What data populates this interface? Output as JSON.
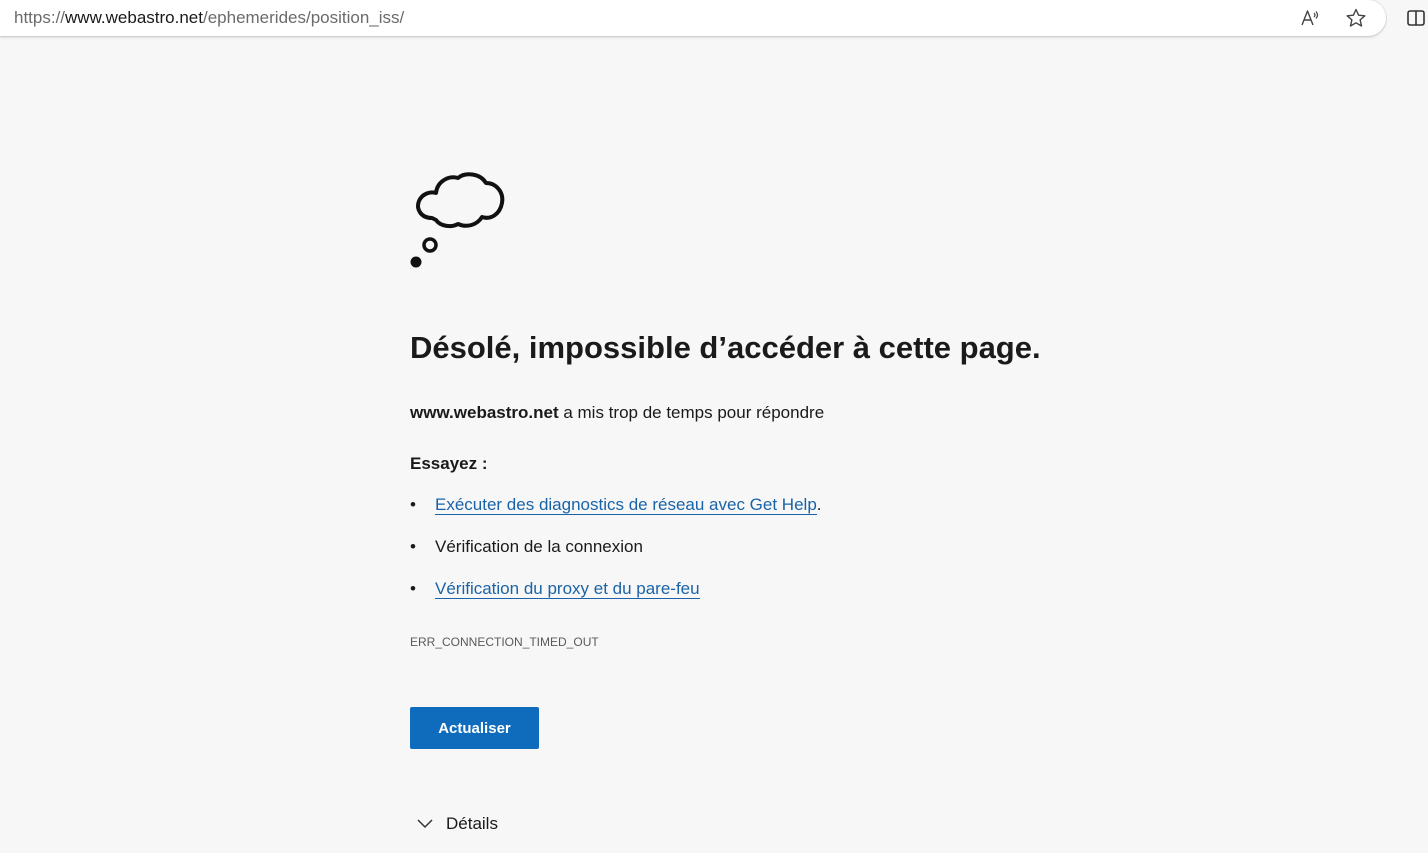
{
  "browser": {
    "url_scheme": "https://",
    "url_host": "www.webastro.net",
    "url_path": "/ephemerides/position_iss/",
    "icons": [
      "read-aloud-icon",
      "favorite-star-icon",
      "split-screen-icon"
    ]
  },
  "error_page": {
    "illustration": "thought-cloud-icon",
    "title": "Désolé, impossible d’accéder à cette page.",
    "host": "www.webastro.net",
    "message": " a mis trop de temps pour répondre",
    "try_heading": "Essayez :",
    "suggestions": [
      {
        "text": "Exécuter des diagnostics de réseau avec Get Help",
        "suffix": ".",
        "is_link": true
      },
      {
        "text": "Vérification de la connexion",
        "suffix": "",
        "is_link": false
      },
      {
        "text": "Vérification du proxy et du pare-feu",
        "suffix": "",
        "is_link": true
      }
    ],
    "bullet": "•",
    "error_code": "ERR_CONNECTION_TIMED_OUT",
    "refresh_label": "Actualiser",
    "details_label": "Détails"
  },
  "colors": {
    "background": "#f7f7f7",
    "link": "#1a63a8",
    "button": "#0f6cbd",
    "text": "#1a1a1a"
  }
}
